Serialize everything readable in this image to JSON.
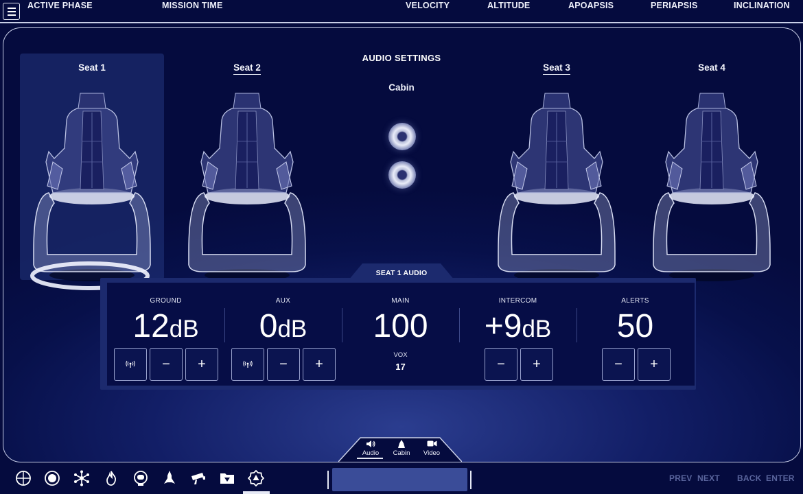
{
  "topbar": {
    "labels": [
      "ACTIVE PHASE",
      "MISSION TIME",
      "VELOCITY",
      "ALTITUDE",
      "APOAPSIS",
      "PERIAPSIS",
      "INCLINATION"
    ]
  },
  "audio_settings": {
    "title": "AUDIO SETTINGS",
    "cabin_label": "Cabin"
  },
  "seats": [
    {
      "label": "Seat 1",
      "selected": true
    },
    {
      "label": "Seat 2",
      "selected": false
    },
    {
      "label": "Seat 3",
      "selected": false
    },
    {
      "label": "Seat 4",
      "selected": false
    }
  ],
  "seat_audio": {
    "title": "SEAT 1 AUDIO",
    "channels": [
      {
        "label": "GROUND",
        "value": "12",
        "unit": "dB"
      },
      {
        "label": "AUX",
        "value": "0",
        "unit": "dB"
      },
      {
        "label": "MAIN",
        "value": "100",
        "unit": ""
      },
      {
        "label": "INTERCOM",
        "value": "+9",
        "unit": "dB"
      },
      {
        "label": "ALERTS",
        "value": "50",
        "unit": ""
      }
    ],
    "vox_label": "VOX",
    "vox_value": "17",
    "minus": "−",
    "plus": "+"
  },
  "mode_tabs": [
    {
      "label": "Audio",
      "icon": "speaker-icon",
      "active": true
    },
    {
      "label": "Cabin",
      "icon": "spacecraft-icon",
      "active": false
    },
    {
      "label": "Video",
      "icon": "video-camera-icon",
      "active": false
    }
  ],
  "bottom_nav": {
    "icons": [
      "crosshair-icon",
      "target-ring-icon",
      "network-icon",
      "flame-icon",
      "astronaut-icon",
      "rocket-icon",
      "camera-icon",
      "folder-icon",
      "settings-icon"
    ],
    "active_icon": "settings-icon",
    "keys": {
      "prev": "PREV",
      "next": "NEXT",
      "back": "BACK",
      "enter": "ENTER"
    }
  },
  "colors": {
    "background": "#050b3e",
    "panel_frame": "#1c2a6e",
    "input_field": "#3a4c98",
    "muted_key": "#59649c"
  }
}
